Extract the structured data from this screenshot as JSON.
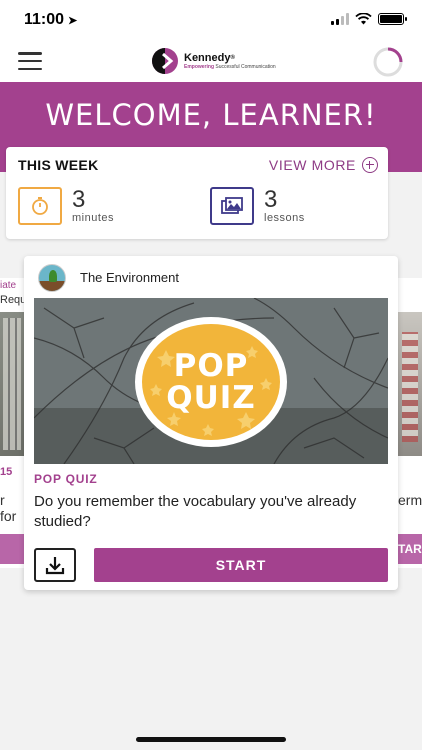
{
  "status_bar": {
    "time": "11:00",
    "location_arrow": "➤"
  },
  "nav": {
    "menu_icon": "hamburger-icon",
    "logo": {
      "brand": "Kennedy",
      "registered": "®",
      "tagline_highlight": "Empowering",
      "tagline_rest": " Successful Communication"
    },
    "progress_icon": "progress-ring-icon"
  },
  "banner": {
    "title": "WELCOME, LEARNER!"
  },
  "this_week": {
    "label": "THIS WEEK",
    "view_more": "VIEW MORE",
    "stats": [
      {
        "value": "3",
        "unit": "minutes",
        "icon": "stopwatch-icon"
      },
      {
        "value": "3",
        "unit": "lessons",
        "icon": "gallery-icon"
      }
    ]
  },
  "carousel_left": {
    "tag": "iate",
    "subtitle": "Requ",
    "number": "15",
    "text": "r for"
  },
  "carousel_right": {
    "text": "erm",
    "button": "TAR"
  },
  "quiz_card": {
    "topic": "The Environment",
    "badge_line1": "POP",
    "badge_line2": "QUIZ",
    "tag": "POP QUIZ",
    "question": "Do you remember the vocabulary you've already studied?",
    "start_label": "START",
    "download_icon": "download-icon"
  },
  "colors": {
    "brand_purple": "#a3418e",
    "stopwatch_orange": "#f0a943",
    "lessons_indigo": "#3f3a8a",
    "badge_gold": "#f2b53a"
  }
}
